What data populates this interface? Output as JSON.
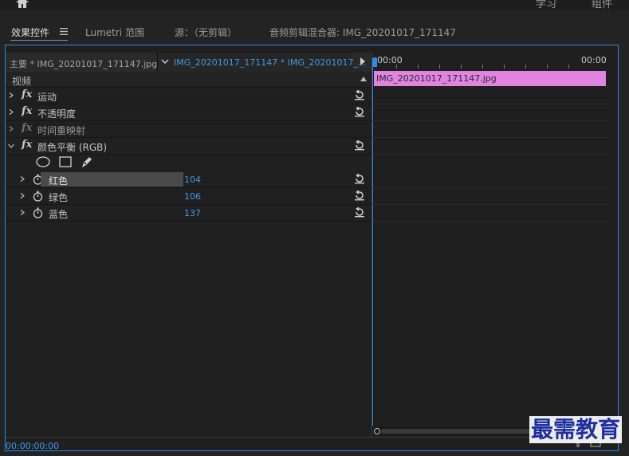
{
  "workspaces": {
    "learn": "学习",
    "assemble": "组件"
  },
  "tabs": [
    {
      "label": "效果控件",
      "active": true
    },
    {
      "label": "Lumetri 范围",
      "active": false
    },
    {
      "label": "源：（无剪辑）",
      "active": false
    },
    {
      "label": "音频剪辑混合器: IMG_20201017_171147",
      "active": false
    }
  ],
  "source": {
    "master": "主要 * IMG_20201017_171147.jpg",
    "clip": "IMG_20201017_171147 * IMG_20201017_..."
  },
  "timeline": {
    "start_time": "00:00",
    "end_time": "00:00",
    "clip_name": "IMG_20201017_171147.jpg"
  },
  "section_label": "视频",
  "effects": [
    {
      "name": "运动",
      "fx": "fx"
    },
    {
      "name": "不透明度",
      "fx": "fx"
    },
    {
      "name": "时间重映射",
      "fx": "fx"
    },
    {
      "name": "颜色平衡 (RGB)",
      "fx": "fx"
    }
  ],
  "params": [
    {
      "name": "红色",
      "value": "104"
    },
    {
      "name": "绿色",
      "value": "106"
    },
    {
      "name": "蓝色",
      "value": "137"
    }
  ],
  "timecode": "00:00:00:00",
  "watermark": "最需教育",
  "colors": {
    "accent": "#2d8ceb",
    "clip": "#e084e0",
    "value": "#3e9ae8"
  }
}
